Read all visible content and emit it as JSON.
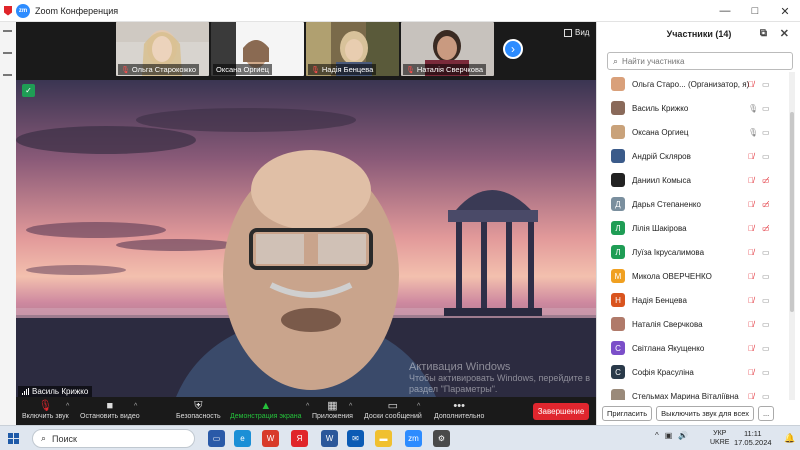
{
  "window": {
    "title": "Zoom Конференция",
    "controls": [
      "—",
      "□",
      "✕"
    ]
  },
  "gallery": {
    "thumbnails": [
      {
        "name": "Ольга Старокожко",
        "muted": true
      },
      {
        "name": "Оксана Оргиец",
        "muted": false
      },
      {
        "name": "Надія Бенцева",
        "muted": true
      },
      {
        "name": "Наталія Сверчкова",
        "muted": true
      }
    ],
    "view_label": "Вид"
  },
  "speaker": {
    "name": "Василь Крижко"
  },
  "activation_watermark": {
    "line1": "Активация Windows",
    "line2": "Чтобы активировать Windows, перейдите в",
    "line3": "раздел \"Параметры\"."
  },
  "toolbar": {
    "mute_label": "Включить звук",
    "video_label": "Остановить видео",
    "security_label": "Безопасность",
    "share_label": "Демонстрация экрана",
    "apps_label": "Приложения",
    "whiteboard_label": "Доски сообщений",
    "more_label": "Дополнительно",
    "end_label": "Завершение"
  },
  "participants_panel": {
    "title": "Участники (14)",
    "search_placeholder": "Найти участника",
    "participants": [
      {
        "name": "Ольга Старо...  (Организатор, я)",
        "initial": "",
        "color": "#d9a07a",
        "mic": "muted",
        "cam": "on"
      },
      {
        "name": "Василь Крижко",
        "initial": "",
        "color": "#8a6a5a",
        "mic": "on",
        "cam": "on"
      },
      {
        "name": "Оксана Оргиец",
        "initial": "",
        "color": "#c9a27a",
        "mic": "on",
        "cam": "on"
      },
      {
        "name": "Андрій Скляров",
        "initial": "",
        "color": "#3b5b8a",
        "mic": "muted",
        "cam": "on"
      },
      {
        "name": "Даниил Комыса",
        "initial": "",
        "color": "#222222",
        "mic": "muted",
        "cam": "off"
      },
      {
        "name": "Дарья Степаненко",
        "initial": "Д",
        "color": "#7a8f9e",
        "mic": "muted",
        "cam": "off"
      },
      {
        "name": "Лілія Шакірова",
        "initial": "Л",
        "color": "#1f9d55",
        "mic": "muted",
        "cam": "off"
      },
      {
        "name": "Луїза Ікрусалимова",
        "initial": "Л",
        "color": "#1f9d55",
        "mic": "muted",
        "cam": "on"
      },
      {
        "name": "Микола ОВЕРЧЕНКО",
        "initial": "М",
        "color": "#f0a020",
        "mic": "muted",
        "cam": "on"
      },
      {
        "name": "Надія Бенцева",
        "initial": "Н",
        "color": "#d9541e",
        "mic": "muted",
        "cam": "on"
      },
      {
        "name": "Наталія Сверчкова",
        "initial": "",
        "color": "#b07a6a",
        "mic": "muted",
        "cam": "on"
      },
      {
        "name": "Світлана Якущенко",
        "initial": "С",
        "color": "#7b4fc9",
        "mic": "muted",
        "cam": "on"
      },
      {
        "name": "Софія Красуліна",
        "initial": "С",
        "color": "#2a3a4a",
        "mic": "muted",
        "cam": "on"
      },
      {
        "name": "Стельмах Марина Віталіївна",
        "initial": "",
        "color": "#9a8a7a",
        "mic": "muted",
        "cam": "on"
      }
    ],
    "invite_label": "Пригласить",
    "unmute_all_label": "Выключить звук для всех",
    "more_label": "..."
  },
  "taskbar": {
    "search_label": "Поиск",
    "lang_line1": "УКР",
    "lang_line2": "UKRE",
    "time": "11:11",
    "date": "17.05.2024"
  }
}
